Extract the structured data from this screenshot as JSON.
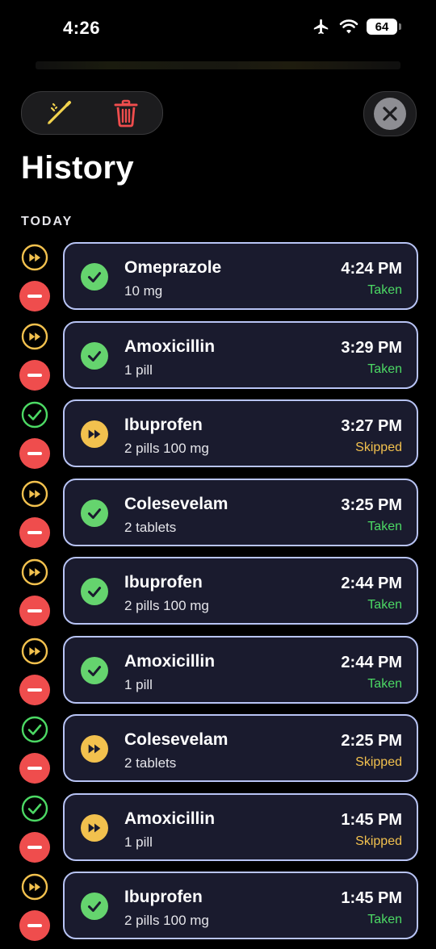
{
  "status_bar": {
    "time": "4:26",
    "battery": "64"
  },
  "toolbar": {
    "edit_icon": "pencil-icon",
    "delete_icon": "trash-icon",
    "close_icon": "close-icon"
  },
  "page": {
    "title": "History",
    "section": "TODAY"
  },
  "colors": {
    "taken": "#4cd964",
    "skipped": "#f2c14e",
    "delete": "#ef4d4d",
    "card_bg": "#1a1b2e",
    "card_border": "#b8c4f5"
  },
  "history": [
    {
      "name": "Omeprazole",
      "dose": "10 mg",
      "time": "4:24 PM",
      "status": "Taken",
      "state": "taken",
      "action": "skip"
    },
    {
      "name": "Amoxicillin",
      "dose": "1 pill",
      "time": "3:29 PM",
      "status": "Taken",
      "state": "taken",
      "action": "skip"
    },
    {
      "name": "Ibuprofen",
      "dose": "2 pills 100 mg",
      "time": "3:27 PM",
      "status": "Skipped",
      "state": "skipped",
      "action": "take"
    },
    {
      "name": "Colesevelam",
      "dose": "2 tablets",
      "time": "3:25 PM",
      "status": "Taken",
      "state": "taken",
      "action": "skip"
    },
    {
      "name": "Ibuprofen",
      "dose": "2 pills 100 mg",
      "time": "2:44 PM",
      "status": "Taken",
      "state": "taken",
      "action": "skip"
    },
    {
      "name": "Amoxicillin",
      "dose": "1 pill",
      "time": "2:44 PM",
      "status": "Taken",
      "state": "taken",
      "action": "skip"
    },
    {
      "name": "Colesevelam",
      "dose": "2 tablets",
      "time": "2:25 PM",
      "status": "Skipped",
      "state": "skipped",
      "action": "take"
    },
    {
      "name": "Amoxicillin",
      "dose": "1 pill",
      "time": "1:45 PM",
      "status": "Skipped",
      "state": "skipped",
      "action": "take"
    },
    {
      "name": "Ibuprofen",
      "dose": "2 pills 100 mg",
      "time": "1:45 PM",
      "status": "Taken",
      "state": "taken",
      "action": "skip"
    }
  ]
}
